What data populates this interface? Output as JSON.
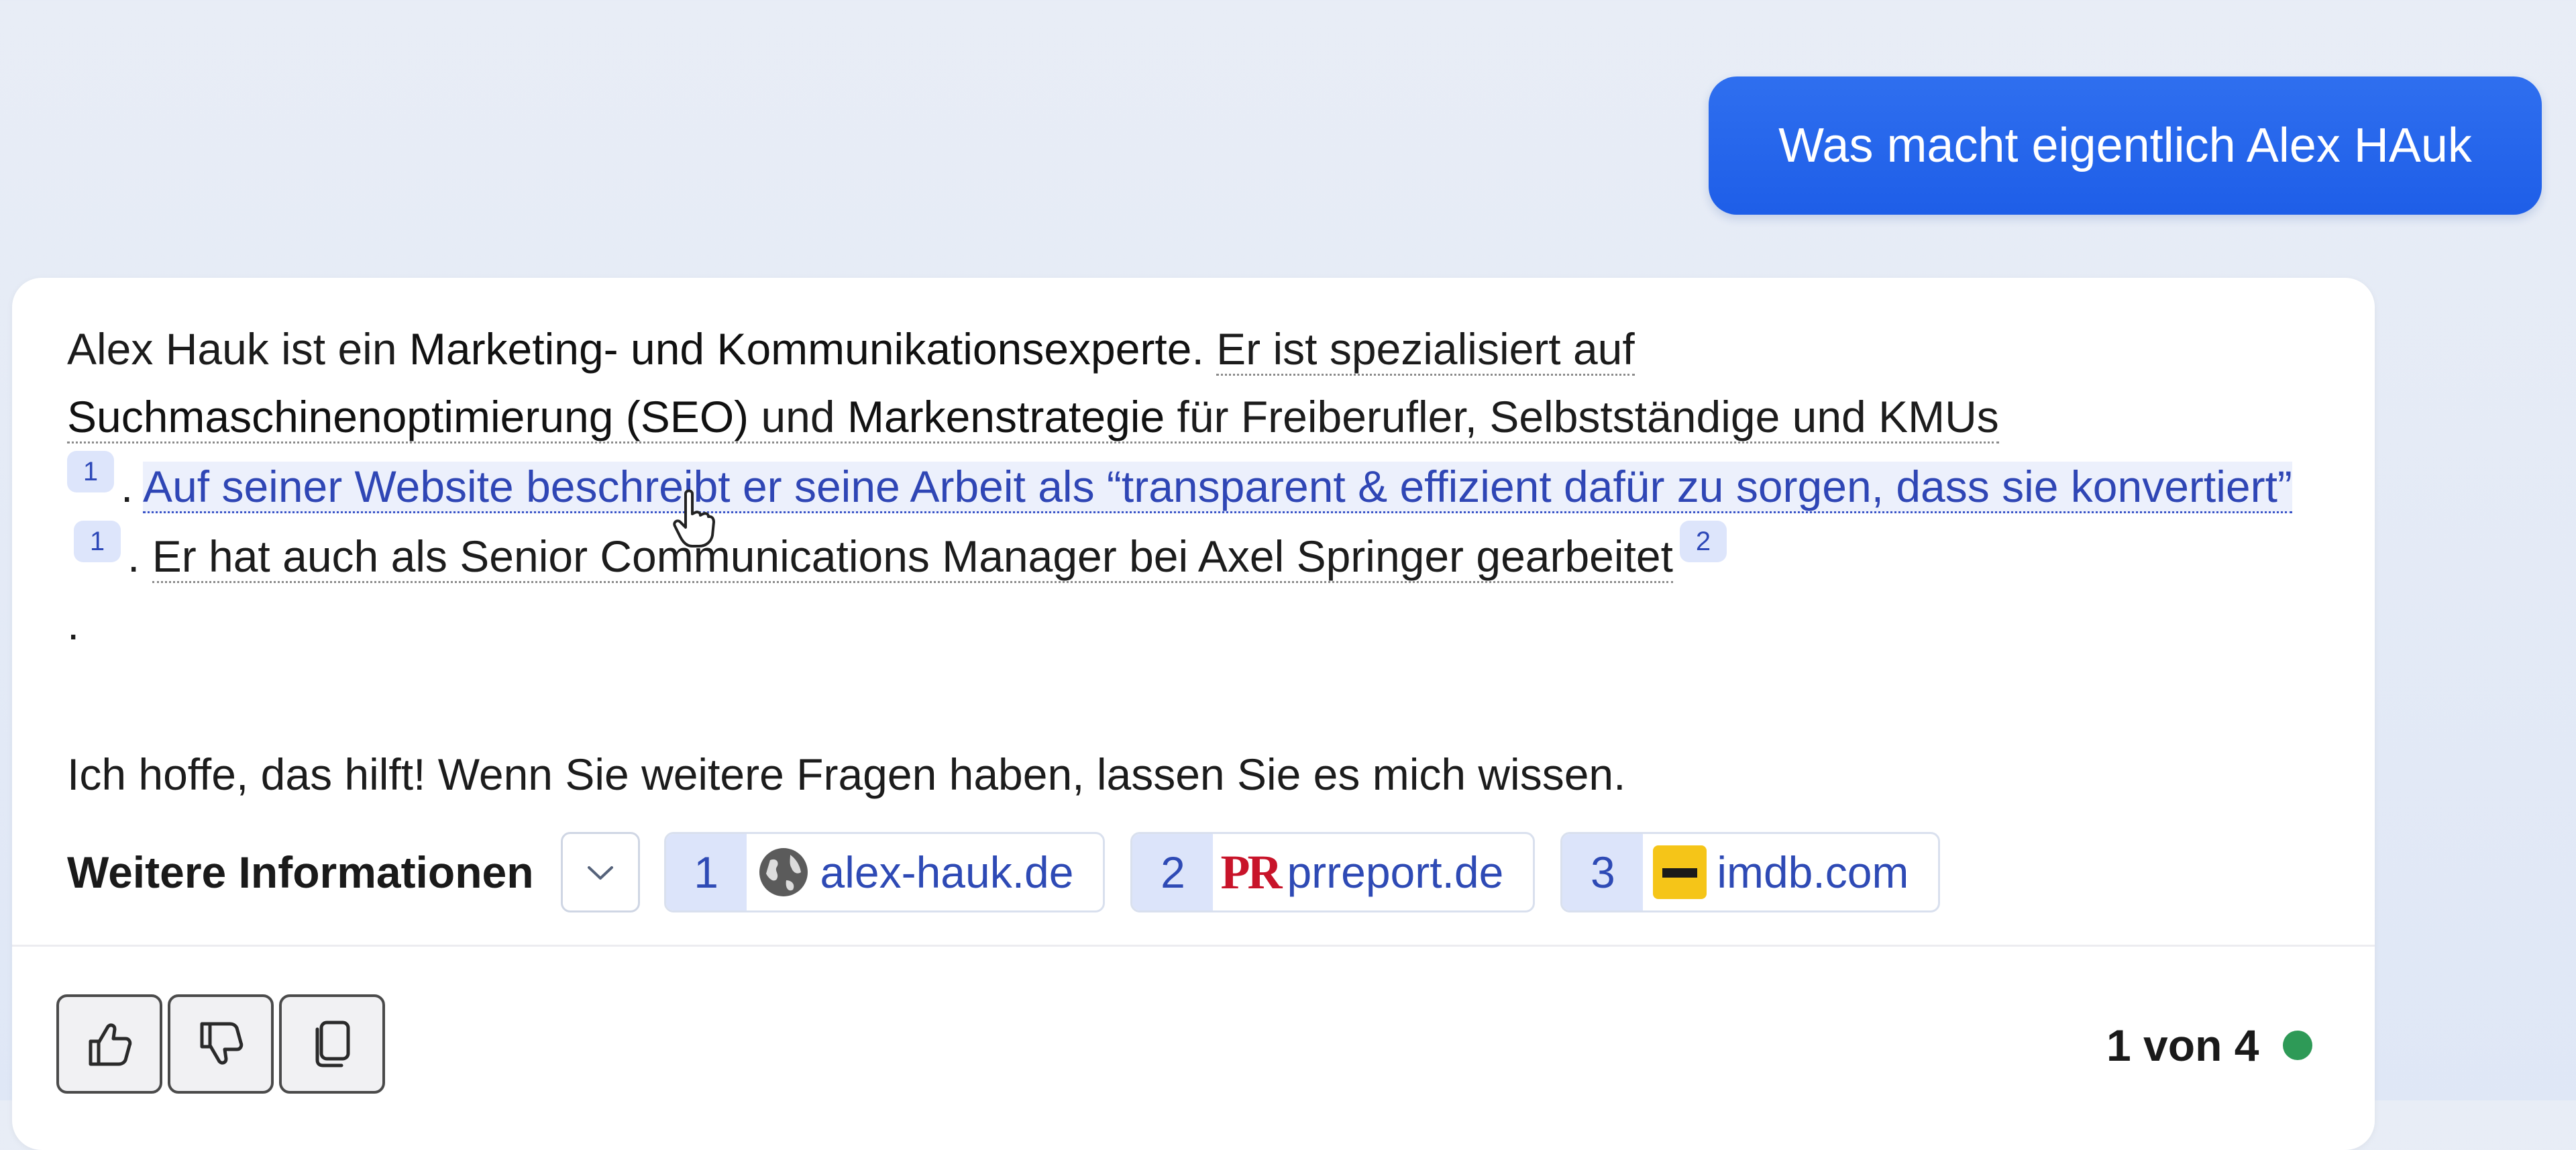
{
  "user_message": "Was macht eigentlich Alex HAuk",
  "answer": {
    "p1_a": "Alex Hauk ist ein ",
    "p1_b": "Marketing- und Kommunikationsexperte",
    "p1_c": ". ",
    "p1_d": "Er ist spezialisiert auf",
    "p1_e": "Suchmaschinenoptimierung (SEO)",
    "p1_f": " und ",
    "p1_g": "Markenstrategie",
    "p1_h": " für Freiberufler, Selbstständige und KMUs",
    "cite1": "1",
    "p1_i": ". ",
    "p1_link": "Auf seiner Website beschreibt er seine Arbeit als “transparent & effizient dafür zu sorgen, dass sie konvertiert”",
    "cite2": "1",
    "p1_j": ". ",
    "p1_k": "Er hat auch als Senior Communications Manager bei Axel Springer gearbeitet",
    "cite3": "2",
    "p1_end": ".",
    "p2": "Ich hoffe, das hilft! Wenn Sie weitere Fragen haben, lassen Sie es mich wissen."
  },
  "more_info": {
    "label": "Weitere Informationen",
    "sources": [
      {
        "num": "1",
        "domain": "alex-hauk.de",
        "icon": "globe-icon"
      },
      {
        "num": "2",
        "domain": "prreport.de",
        "icon": "pr-logo"
      },
      {
        "num": "3",
        "domain": "imdb.com",
        "icon": "imdb-logo"
      }
    ]
  },
  "pr_logo_text": "PR",
  "pager": "1 von 4",
  "colors": {
    "accent": "#1e5ee8",
    "link": "#2e4ab5",
    "status": "#2e9a57"
  }
}
